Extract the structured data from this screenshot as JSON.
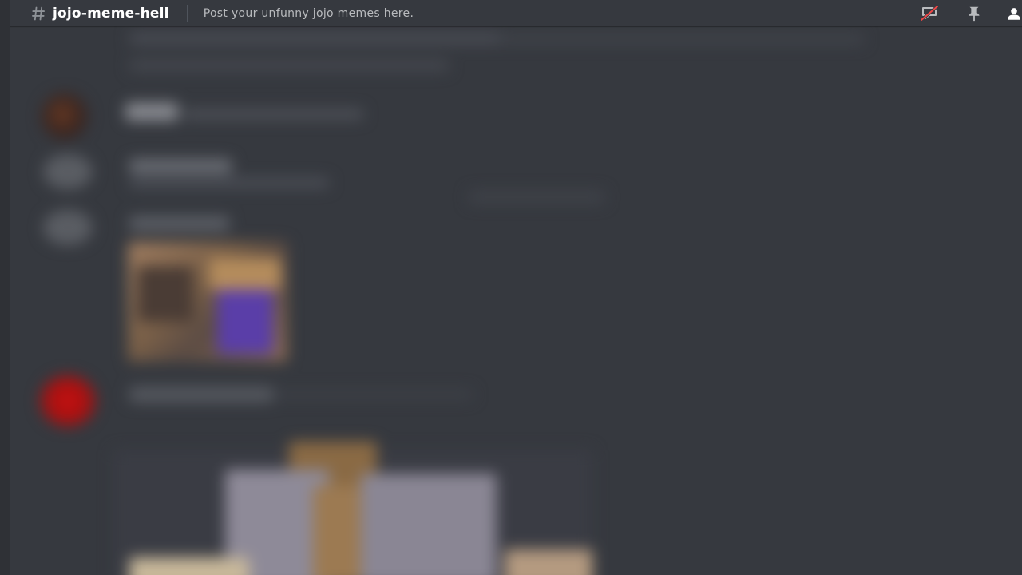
{
  "channel": {
    "icon": "hash-icon",
    "name": "jojo-meme-hell",
    "topic": "Post your unfunny jojo memes here."
  },
  "toolbar": {
    "icons": [
      "notification-muted-icon",
      "pin-icon",
      "member-list-icon"
    ],
    "notification_muted_color": "#f04747"
  },
  "colors": {
    "background": "#36393f",
    "sidebar": "#2f3136",
    "header_text": "#ffffff",
    "topic_text": "#b9bbbe",
    "icon": "#b9bbbe"
  }
}
